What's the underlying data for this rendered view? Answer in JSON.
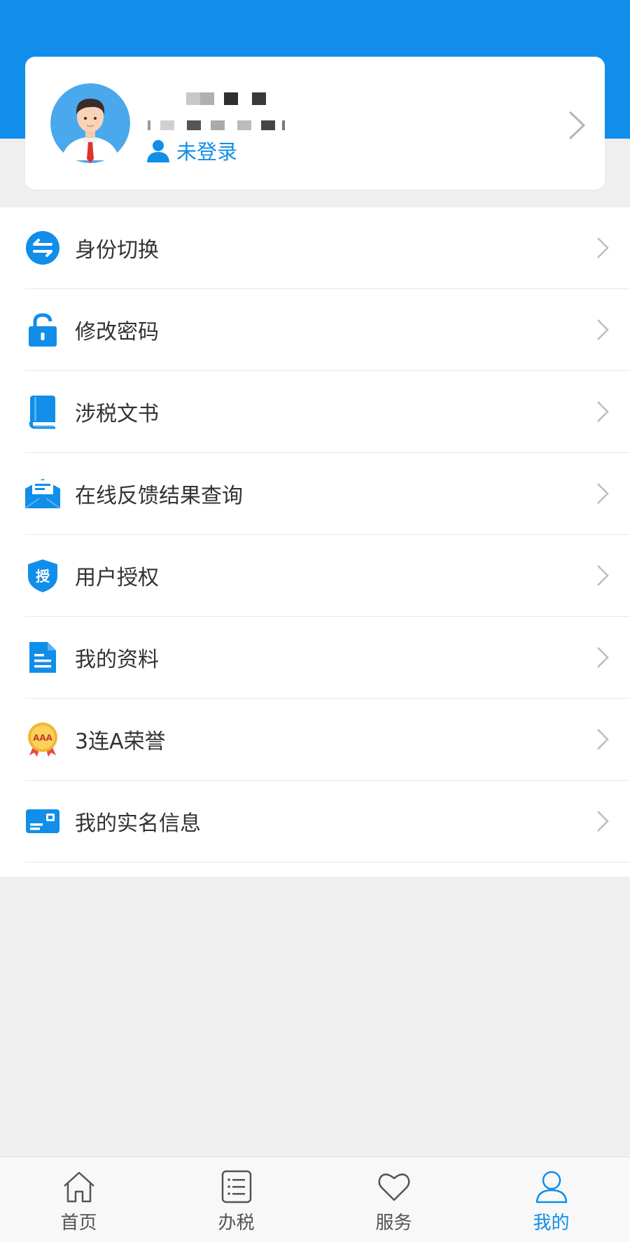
{
  "colors": {
    "accent": "#108ee9",
    "background": "#efefef",
    "text": "#333333",
    "tab_inactive": "#555555"
  },
  "profile": {
    "avatar_icon": "user-avatar-icon",
    "status_label": "未登录"
  },
  "menu": {
    "items": [
      {
        "label": "身份切换",
        "icon": "switch-identity-icon"
      },
      {
        "label": "修改密码",
        "icon": "unlock-icon"
      },
      {
        "label": "涉税文书",
        "icon": "book-icon"
      },
      {
        "label": "在线反馈结果查询",
        "icon": "mail-icon"
      },
      {
        "label": "用户授权",
        "icon": "shield-authorize-icon",
        "badge": "授"
      },
      {
        "label": "我的资料",
        "icon": "document-icon"
      },
      {
        "label": "3连A荣誉",
        "icon": "aaa-medal-icon",
        "badge": "AAA"
      },
      {
        "label": "我的实名信息",
        "icon": "id-card-icon"
      }
    ]
  },
  "tabbar": {
    "tabs": [
      {
        "label": "首页",
        "icon": "home-icon",
        "active": false
      },
      {
        "label": "办税",
        "icon": "list-icon",
        "active": false
      },
      {
        "label": "服务",
        "icon": "heart-icon",
        "active": false
      },
      {
        "label": "我的",
        "icon": "user-icon",
        "active": true
      }
    ]
  }
}
